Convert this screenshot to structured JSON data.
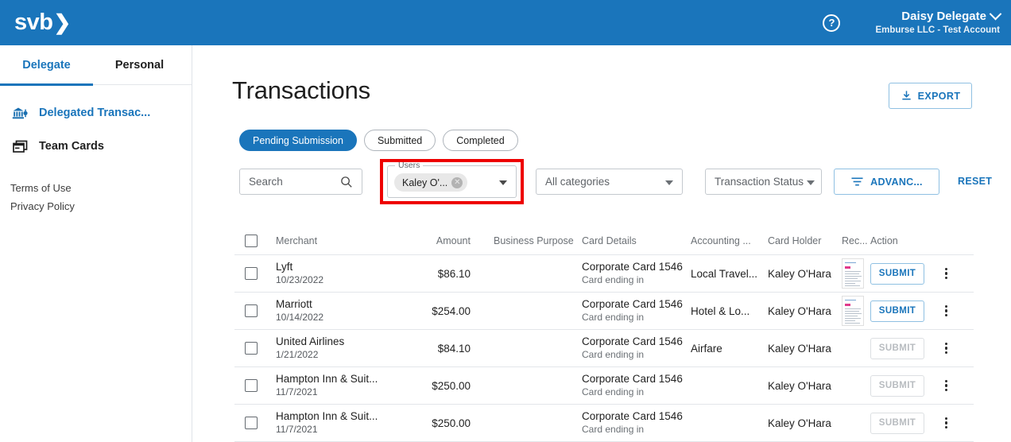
{
  "topbar": {
    "logo_text": "svb",
    "logo_chevron": "❯",
    "help_glyph": "?",
    "user_name": "Daisy Delegate",
    "user_org": "Emburse LLC - Test Account"
  },
  "sidebar": {
    "tabs": [
      {
        "label": "Delegate",
        "active": true
      },
      {
        "label": "Personal",
        "active": false
      }
    ],
    "items": [
      {
        "label": "Delegated Transac...",
        "icon": "bank-delegate-icon",
        "active": true
      },
      {
        "label": "Team Cards",
        "icon": "team-cards-icon",
        "active": false
      }
    ],
    "footer_links": [
      {
        "label": "Terms of Use"
      },
      {
        "label": "Privacy Policy"
      }
    ]
  },
  "main": {
    "title": "Transactions",
    "export_label": "EXPORT",
    "status_chips": [
      {
        "label": "Pending Submission",
        "active": true
      },
      {
        "label": "Submitted",
        "active": false
      },
      {
        "label": "Completed",
        "active": false
      }
    ],
    "filters": {
      "search_placeholder": "Search",
      "users_legend": "Users",
      "users_chip_label": "Kaley O'...",
      "users_chip_remove": "✕",
      "categories_value": "All categories",
      "status_value": "Transaction Status",
      "advanced_label": "ADVANC...",
      "reset_label": "RESET"
    },
    "table": {
      "columns": [
        "Merchant",
        "Amount",
        "Business Purpose",
        "Card Details",
        "Accounting ...",
        "Card Holder",
        "Rec...",
        "Action"
      ],
      "rows": [
        {
          "merchant": "Lyft",
          "date": "10/23/2022",
          "amount": "$86.10",
          "business_purpose": "",
          "card_main": "Corporate Card 1546",
          "card_sub": "Card ending in",
          "accounting": "Local Travel...",
          "card_holder": "Kaley O'Hara",
          "receipt": true,
          "action_label": "SUBMIT",
          "action_enabled": true
        },
        {
          "merchant": "Marriott",
          "date": "10/14/2022",
          "amount": "$254.00",
          "business_purpose": "",
          "card_main": "Corporate Card 1546",
          "card_sub": "Card ending in",
          "accounting": "Hotel & Lo...",
          "card_holder": "Kaley O'Hara",
          "receipt": true,
          "action_label": "SUBMIT",
          "action_enabled": true
        },
        {
          "merchant": "United Airlines",
          "date": "1/21/2022",
          "amount": "$84.10",
          "business_purpose": "",
          "card_main": "Corporate Card 1546",
          "card_sub": "Card ending in",
          "accounting": "Airfare",
          "card_holder": "Kaley O'Hara",
          "receipt": false,
          "action_label": "SUBMIT",
          "action_enabled": false
        },
        {
          "merchant": "Hampton Inn & Suit...",
          "date": "11/7/2021",
          "amount": "$250.00",
          "business_purpose": "",
          "card_main": "Corporate Card 1546",
          "card_sub": "Card ending in",
          "accounting": "",
          "card_holder": "Kaley O'Hara",
          "receipt": false,
          "action_label": "SUBMIT",
          "action_enabled": false
        },
        {
          "merchant": "Hampton Inn & Suit...",
          "date": "11/7/2021",
          "amount": "$250.00",
          "business_purpose": "",
          "card_main": "Corporate Card 1546",
          "card_sub": "Card ending in",
          "accounting": "",
          "card_holder": "Kaley O'Hara",
          "receipt": false,
          "action_label": "SUBMIT",
          "action_enabled": false
        }
      ]
    }
  },
  "colors": {
    "brand_blue": "#1a75bb",
    "highlight_red": "#ee0000",
    "text_dark": "#1f1f1f",
    "text_muted": "#6b7075"
  }
}
